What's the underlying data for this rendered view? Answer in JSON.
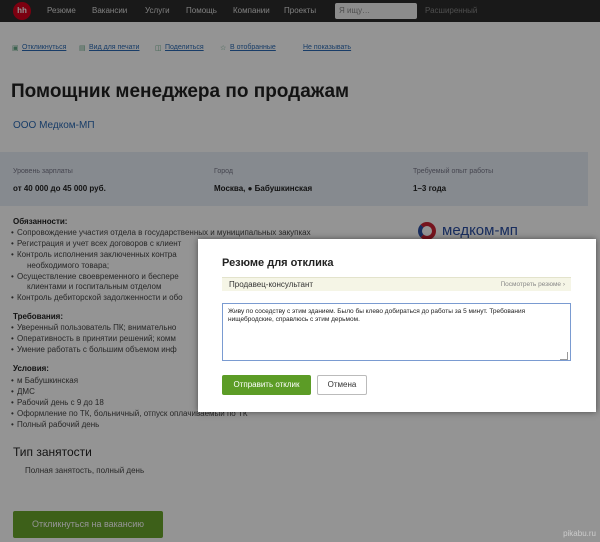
{
  "nav": {
    "logo": "hh",
    "items": [
      "Резюме",
      "Вакансии",
      "Услуги",
      "Помощь",
      "Компании",
      "Проекты"
    ],
    "search_placeholder": "Я ищу…",
    "search_button": "Расширенный"
  },
  "actions": [
    "Откликнуться",
    "Вид для печати",
    "Поделиться",
    "В отобранные",
    "Не показывать"
  ],
  "vacancy": {
    "title": "Помощник менеджера по продажам",
    "company": "ООО Медком-МП",
    "salary_label": "Уровень зарплаты",
    "salary_value": "от 40 000 до 45 000 руб.",
    "city_label": "Город",
    "city_value": "Москва, ● Бабушкинская",
    "experience_label": "Требуемый опыт работы",
    "experience_value": "1–3 года"
  },
  "duties": {
    "title": "Обязанности:",
    "items": [
      "Сопровождение участия отдела в государственных и муниципальных закупках",
      "Регистрация и учет всех договоров с клиент",
      "Контроль исполнения заключенных контра",
      "Осуществление своевременного и беспере",
      "Контроль дебиторской задолженности и обо"
    ],
    "continuations": [
      "необходимого товара;",
      "клиентами и госпитальным отделом"
    ]
  },
  "requirements": {
    "title": "Требования:",
    "items": [
      "Уверенный пользователь ПК; внимательно",
      "Оперативность в принятии решений; комм",
      "Умение работать с большим объемом инф"
    ]
  },
  "conditions": {
    "title": "Условия:",
    "items": [
      "м Бабушкинская",
      "ДМС",
      "Рабочий день с 9 до 18",
      "Оформление по ТК, больничный, отпуск оплачиваемый по ТК",
      "Полный рабочий день"
    ]
  },
  "employment": {
    "title": "Тип занятости",
    "value": "Полная занятость, полный день"
  },
  "apply_button": "Откликнуться на вакансию",
  "company_logo_text": "медком-мп",
  "watermark": "pikabu.ru",
  "modal": {
    "title": "Резюме для отклика",
    "resume_name": "Продавец-консультант",
    "view_resume": "Посмотреть резюме ›",
    "letter": "Живу по соседству с этим зданием. Было бы клево добираться до работы за 5 минут. Требования нищебродские, справлюсь с этим дерьмом.",
    "send_button": "Отправить отклик",
    "cancel_button": "Отмена"
  },
  "colors": {
    "accent_green": "#5c9c26",
    "link_blue": "#2b6ab3",
    "hh_red": "#d6001c"
  }
}
